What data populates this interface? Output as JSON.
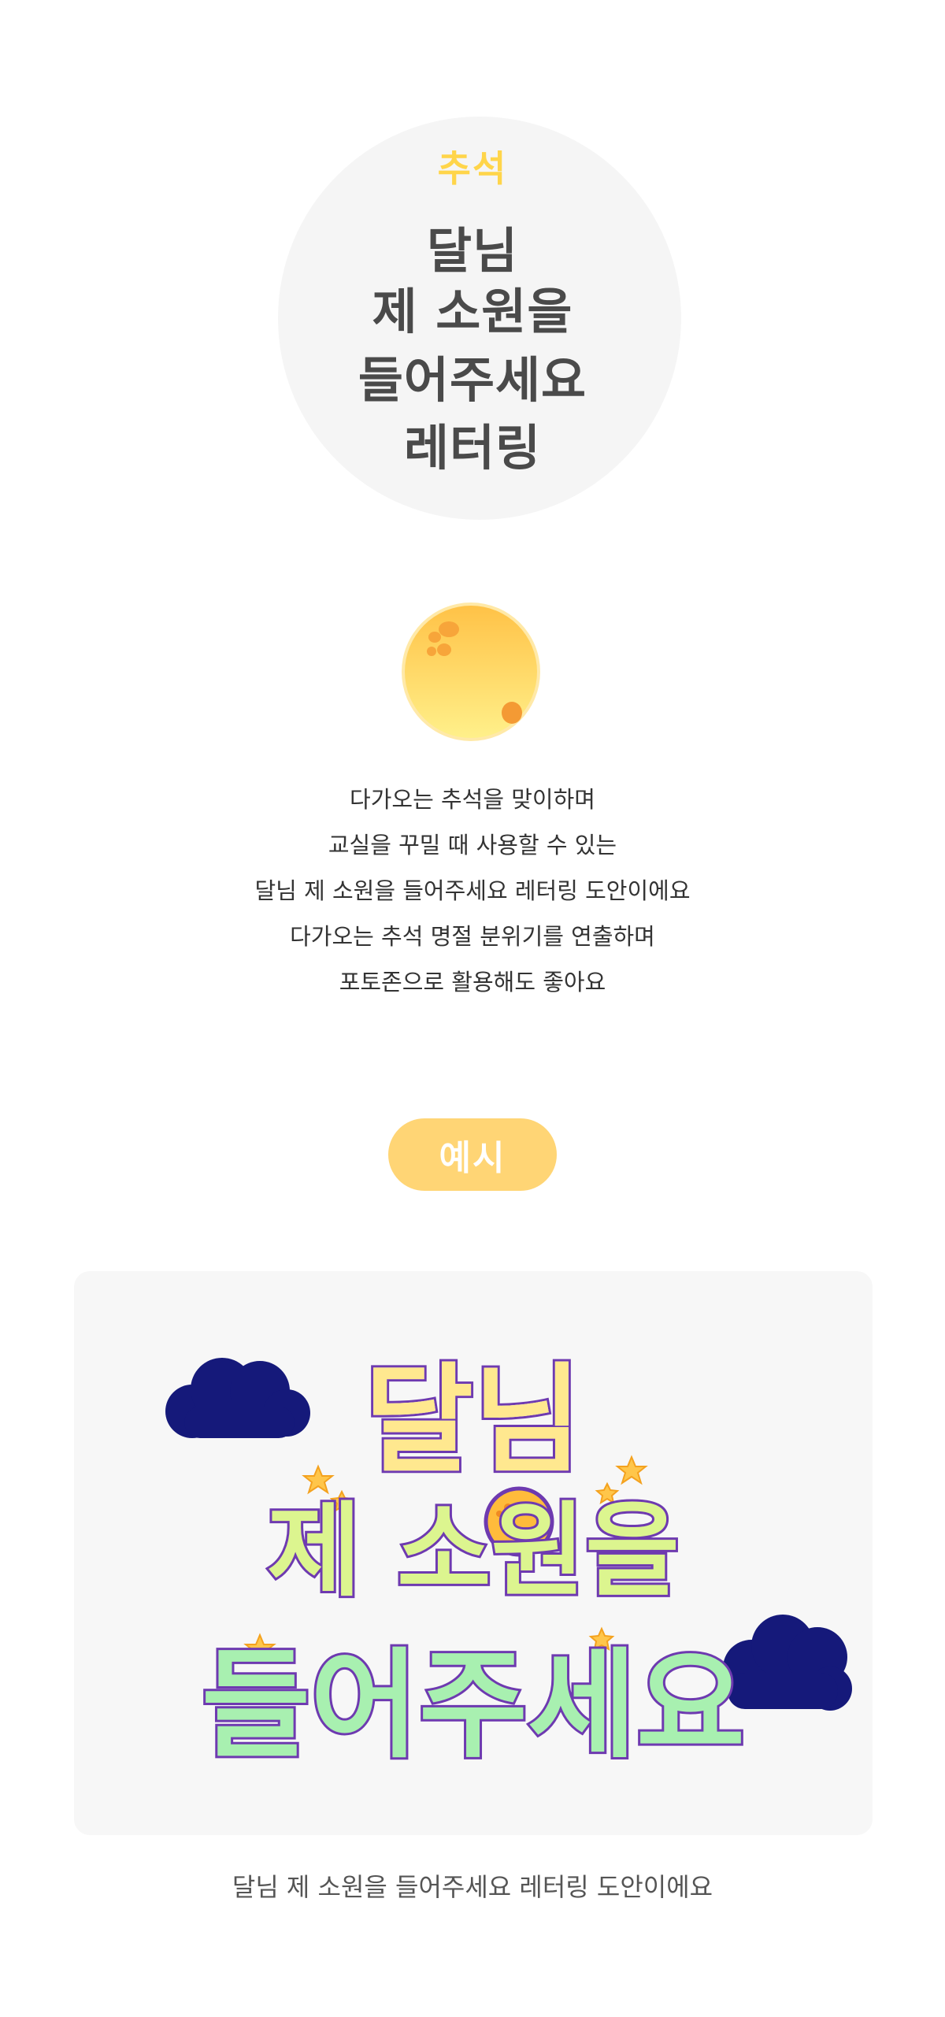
{
  "hero": {
    "kicker": "추석",
    "title_lines": [
      "달님",
      "제 소원을",
      "들어주세요",
      "레터링"
    ]
  },
  "description": [
    "다가오는 추석을 맞이하며",
    "교실을 꾸밀 때 사용할 수 있는",
    "달님 제 소원을 들어주세요 레터링 도안이에요",
    "다가오는 추석 명절 분위기를 연출하며",
    "포토존으로 활용해도 좋아요"
  ],
  "example": {
    "badge_label": "예시",
    "artwork_lines": [
      "달님",
      "제 소원을",
      "들어주세요"
    ],
    "caption": "달님 제 소원을 들어주세요 레터링 도안이에요"
  },
  "colors": {
    "kicker": "#ffd54a",
    "title": "#4a4a4a",
    "badge": "#ffd575",
    "moon": "#ffd86b",
    "cloud": "#15197a"
  },
  "icons": [
    "moon-icon",
    "cloud-icon",
    "star-icon"
  ]
}
